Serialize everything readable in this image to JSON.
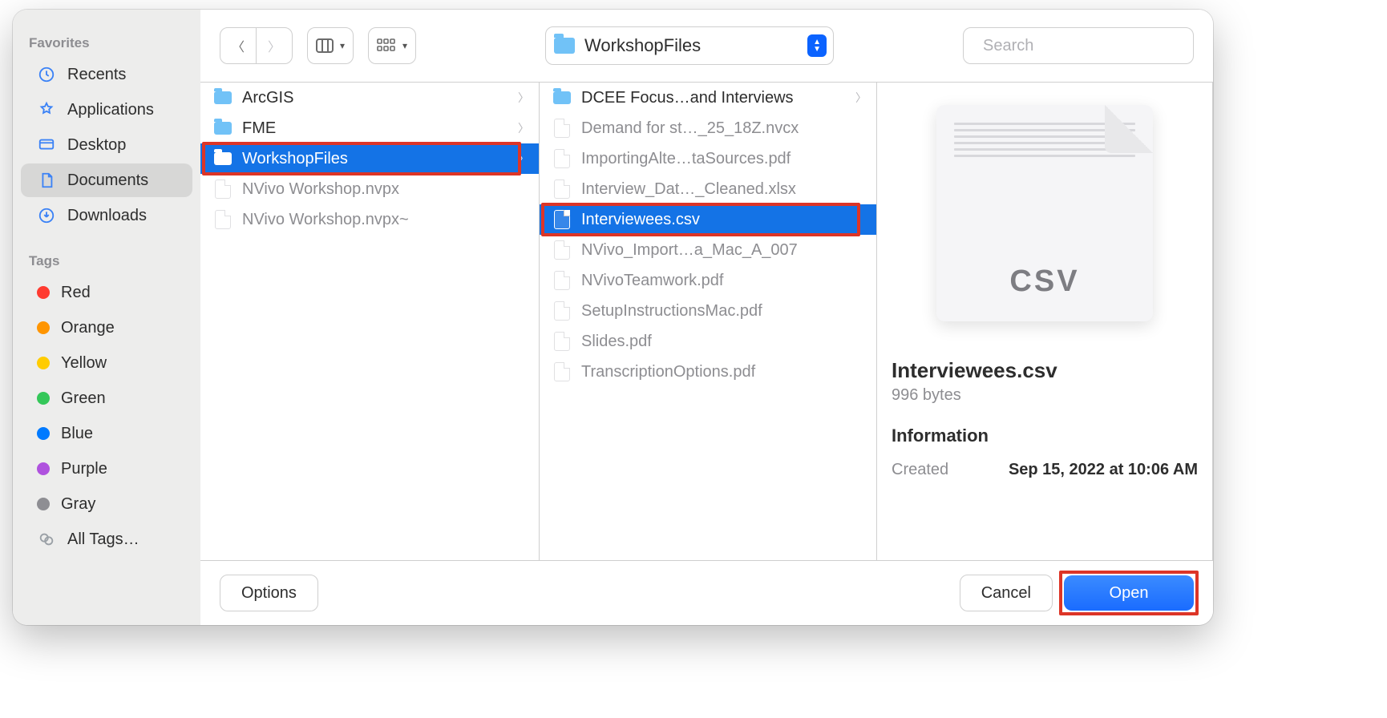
{
  "sidebar": {
    "favorites_heading": "Favorites",
    "tags_heading": "Tags",
    "favorites": [
      {
        "icon": "clock",
        "label": "Recents",
        "selected": false
      },
      {
        "icon": "apps",
        "label": "Applications",
        "selected": false
      },
      {
        "icon": "desktop",
        "label": "Desktop",
        "selected": false
      },
      {
        "icon": "doc",
        "label": "Documents",
        "selected": true
      },
      {
        "icon": "download",
        "label": "Downloads",
        "selected": false
      }
    ],
    "tags": [
      {
        "color": "#ff3b30",
        "label": "Red"
      },
      {
        "color": "#ff9500",
        "label": "Orange"
      },
      {
        "color": "#ffcc00",
        "label": "Yellow"
      },
      {
        "color": "#34c759",
        "label": "Green"
      },
      {
        "color": "#007aff",
        "label": "Blue"
      },
      {
        "color": "#af52de",
        "label": "Purple"
      },
      {
        "color": "#8e8e93",
        "label": "Gray"
      }
    ],
    "all_tags_label": "All Tags…"
  },
  "toolbar": {
    "path_label": "WorkshopFiles",
    "search_placeholder": "Search"
  },
  "col1": [
    {
      "type": "folder",
      "label": "ArcGIS",
      "chevron": true,
      "dim": false,
      "selected": false,
      "highlighted": false
    },
    {
      "type": "folder",
      "label": "FME",
      "chevron": true,
      "dim": false,
      "selected": false,
      "highlighted": false
    },
    {
      "type": "folder",
      "label": "WorkshopFiles",
      "chevron": true,
      "dim": false,
      "selected": true,
      "highlighted": true
    },
    {
      "type": "file",
      "label": "NVivo Workshop.nvpx",
      "dim": true,
      "chevron": false,
      "selected": false,
      "highlighted": false
    },
    {
      "type": "file",
      "label": "NVivo Workshop.nvpx~",
      "dim": true,
      "chevron": false,
      "selected": false,
      "highlighted": false
    }
  ],
  "col2": [
    {
      "type": "folder",
      "label": "DCEE Focus…and Interviews",
      "chevron": true,
      "dim": false,
      "selected": false,
      "highlighted": false
    },
    {
      "type": "file",
      "label": "Demand for st…_25_18Z.nvcx",
      "dim": true,
      "chevron": false,
      "selected": false,
      "highlighted": false
    },
    {
      "type": "file",
      "label": "ImportingAlte…taSources.pdf",
      "dim": true,
      "chevron": false,
      "selected": false,
      "highlighted": false
    },
    {
      "type": "file",
      "label": "Interview_Dat…_Cleaned.xlsx",
      "dim": true,
      "chevron": false,
      "selected": false,
      "highlighted": false
    },
    {
      "type": "file",
      "label": "Interviewees.csv",
      "dim": false,
      "chevron": false,
      "selected": true,
      "highlighted": true
    },
    {
      "type": "file",
      "label": "NVivo_Import…a_Mac_A_007",
      "dim": true,
      "chevron": false,
      "selected": false,
      "highlighted": false
    },
    {
      "type": "file",
      "label": "NVivoTeamwork.pdf",
      "dim": true,
      "chevron": false,
      "selected": false,
      "highlighted": false
    },
    {
      "type": "file",
      "label": "SetupInstructionsMac.pdf",
      "dim": true,
      "chevron": false,
      "selected": false,
      "highlighted": false
    },
    {
      "type": "file",
      "label": "Slides.pdf",
      "dim": true,
      "chevron": false,
      "selected": false,
      "highlighted": false
    },
    {
      "type": "file",
      "label": "TranscriptionOptions.pdf",
      "dim": true,
      "chevron": false,
      "selected": false,
      "highlighted": false
    }
  ],
  "preview": {
    "badge": "CSV",
    "filename": "Interviewees.csv",
    "filesize": "996 bytes",
    "info_heading": "Information",
    "created_label": "Created",
    "created_value": "Sep 15, 2022 at 10:06 AM"
  },
  "footer": {
    "options_label": "Options",
    "cancel_label": "Cancel",
    "open_label": "Open"
  }
}
